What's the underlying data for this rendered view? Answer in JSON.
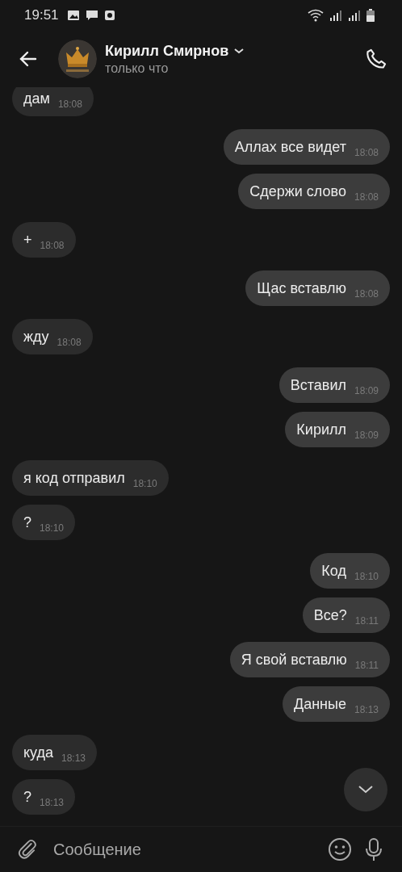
{
  "status_bar": {
    "time": "19:51"
  },
  "header": {
    "name": "Кирилл Смирнов",
    "status": "только что"
  },
  "messages": [
    {
      "outgoing": false,
      "text": "дам",
      "time": "18:08"
    },
    {
      "outgoing": true,
      "text": "Аллах все видет",
      "time": "18:08"
    },
    {
      "outgoing": true,
      "text": "Сдержи слово",
      "time": "18:08"
    },
    {
      "outgoing": false,
      "text": "+",
      "time": "18:08"
    },
    {
      "outgoing": true,
      "text": "Щас вставлю",
      "time": "18:08"
    },
    {
      "outgoing": false,
      "text": "жду",
      "time": "18:08"
    },
    {
      "outgoing": true,
      "text": "Вставил",
      "time": "18:09"
    },
    {
      "outgoing": true,
      "text": "Кирилл",
      "time": "18:09"
    },
    {
      "outgoing": false,
      "text": "я код отправил",
      "time": "18:10"
    },
    {
      "outgoing": false,
      "text": "?",
      "time": "18:10"
    },
    {
      "outgoing": true,
      "text": "Код",
      "time": "18:10"
    },
    {
      "outgoing": true,
      "text": "Все?",
      "time": "18:11"
    },
    {
      "outgoing": true,
      "text": "Я свой вставлю",
      "time": "18:11"
    },
    {
      "outgoing": true,
      "text": "Данные",
      "time": "18:13"
    },
    {
      "outgoing": false,
      "text": "куда",
      "time": "18:13"
    },
    {
      "outgoing": false,
      "text": "?",
      "time": "18:13"
    }
  ],
  "composer": {
    "placeholder": "Сообщение"
  }
}
